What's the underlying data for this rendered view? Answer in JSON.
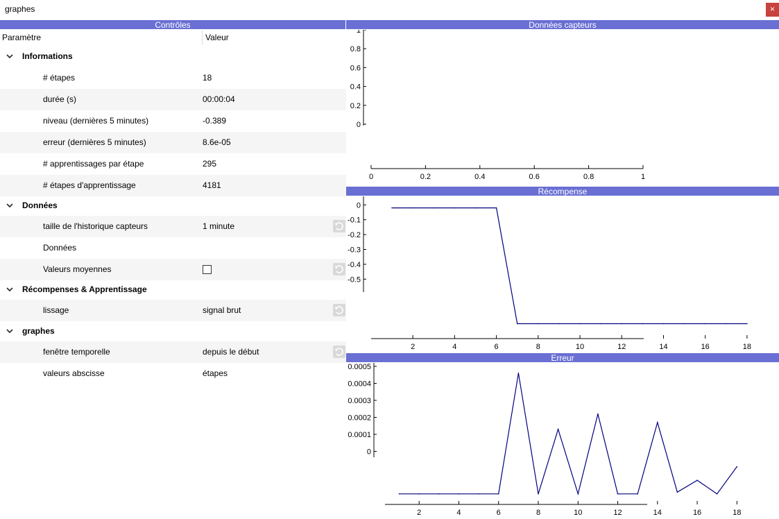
{
  "window": {
    "title": "graphes",
    "close_label": "×"
  },
  "controls": {
    "title": "Contrôles",
    "col_param": "Paramètre",
    "col_value": "Valeur",
    "groups": [
      {
        "label": "Informations",
        "rows": [
          {
            "name": "# étapes",
            "value": "18"
          },
          {
            "name": "durée (s)",
            "value": "00:00:04"
          },
          {
            "name": "niveau (dernières 5 minutes)",
            "value": "-0.389"
          },
          {
            "name": "erreur (dernières 5 minutes)",
            "value": "8.6e-05"
          },
          {
            "name": "# apprentissages par étape",
            "value": "295"
          },
          {
            "name": "# étapes d'apprentissage",
            "value": "4181"
          }
        ]
      },
      {
        "label": "Données",
        "rows": [
          {
            "name": "taille de l'historique capteurs",
            "value": "1 minute"
          },
          {
            "name": "Données",
            "value": ""
          },
          {
            "name": "Valeurs moyennes",
            "value": "",
            "checked": false
          }
        ]
      },
      {
        "label": "Récompenses & Apprentissage",
        "rows": [
          {
            "name": "lissage",
            "value": "signal brut"
          }
        ]
      },
      {
        "label": "graphes",
        "rows": [
          {
            "name": "fenêtre temporelle",
            "value": "depuis le début"
          },
          {
            "name": "valeurs abscisse",
            "value": "étapes"
          }
        ]
      }
    ]
  },
  "chart_data": [
    {
      "type": "line",
      "title": "Données capteurs",
      "xlim": [
        0,
        1
      ],
      "ylim": [
        0,
        1
      ],
      "xticks": [
        "0",
        "0.2",
        "0.4",
        "0.6",
        "0.8",
        "1"
      ],
      "yticks": [
        "0",
        "0.2",
        "0.4",
        "0.6",
        "0.8",
        "1"
      ],
      "series": []
    },
    {
      "type": "line",
      "title": "Récompense",
      "xlim": [
        0.8,
        18.8
      ],
      "ylim": [
        -0.55,
        0.02
      ],
      "xticks": [
        "2",
        "4",
        "6",
        "8",
        "10",
        "12",
        "14",
        "16",
        "18"
      ],
      "yticks": [
        "0",
        "-0.1",
        "-0.2",
        "-0.3",
        "-0.4",
        "-0.5"
      ],
      "series": [
        {
          "color": "#000080",
          "x": [
            1,
            2,
            3,
            4,
            5,
            6,
            7,
            8,
            9,
            10,
            11,
            12,
            13,
            14,
            15,
            16,
            17,
            18
          ],
          "y": [
            -0.02,
            -0.02,
            -0.02,
            -0.02,
            -0.02,
            -0.02,
            -0.8,
            -0.8,
            -0.8,
            -0.8,
            -0.8,
            -0.8,
            -0.8,
            -0.8,
            -0.8,
            -0.8,
            -0.8,
            -0.8
          ]
        }
      ]
    },
    {
      "type": "line",
      "title": "Erreur",
      "xlim": [
        1.05,
        19.35
      ],
      "ylim": [
        -0.0001,
        0.0005
      ],
      "xticks": [
        "2",
        "4",
        "6",
        "8",
        "10",
        "12",
        "14",
        "16",
        "18"
      ],
      "yticks": [
        "0",
        "0.0001",
        "0.0002",
        "0.0003",
        "0.0004",
        "0.0005"
      ],
      "series": [
        {
          "color": "#000080",
          "x": [
            1,
            2,
            3,
            4,
            5,
            6,
            7,
            8,
            9,
            10,
            11,
            12,
            13,
            14,
            15,
            16,
            17,
            18
          ],
          "y": [
            -0.00025,
            -0.00025,
            -0.00025,
            -0.00025,
            -0.00025,
            -0.00025,
            0.00046,
            -0.00025,
            0.00013,
            -0.00025,
            0.00022,
            -0.00025,
            -0.00025,
            0.00017,
            -0.00024,
            -0.00017,
            -0.00025,
            -9e-05
          ]
        }
      ]
    }
  ]
}
